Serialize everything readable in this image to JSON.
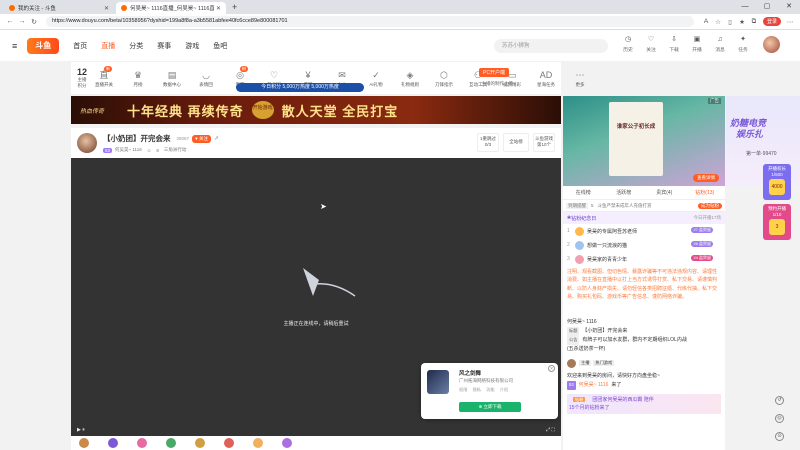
{
  "browser": {
    "tabs": [
      {
        "title": "我的关注 - 斗鱼",
        "active": false
      },
      {
        "title": "何吴昊~ 1116直播_何吴昊~ 1116直播_斗...",
        "active": true
      }
    ],
    "url": "https://www.douyu.com/beta/10358956?dyshid=199a8f8a-a3b5581abfee40fc6cce89e800081701",
    "login_label": "登录"
  },
  "header": {
    "logo": "斗鱼",
    "nav": [
      "首页",
      "直播",
      "分类",
      "赛事",
      "游戏",
      "鱼吧"
    ],
    "nav_active": "直播",
    "search_placeholder": "苏苏小狮狗",
    "right_items": [
      "历史",
      "关注",
      "下载",
      "开播",
      "消息",
      "任务"
    ]
  },
  "toolbar": {
    "level_num": "12",
    "level_label": "主播积分",
    "tools": [
      {
        "label": "直播开关",
        "icon": "直",
        "badge": "新"
      },
      {
        "label": "月榜",
        "icon": "♛",
        "badge": ""
      },
      {
        "label": "数据中心",
        "icon": "▤",
        "badge": ""
      },
      {
        "label": "表情回",
        "icon": "◡",
        "badge": ""
      },
      {
        "label": "贵宾",
        "icon": "◎",
        "badge": "粉"
      },
      {
        "label": "粉丝团",
        "icon": "♡",
        "badge": ""
      },
      {
        "label": "提现",
        "icon": "¥",
        "badge": ""
      },
      {
        "label": "中心",
        "icon": "✉",
        "badge": ""
      },
      {
        "label": "AI礼物",
        "icon": "✓",
        "badge": ""
      },
      {
        "label": "礼物规则",
        "icon": "◈",
        "badge": ""
      },
      {
        "label": "刀锋指示",
        "icon": "⬡",
        "badge": ""
      },
      {
        "label": "互动工具",
        "icon": "⚇",
        "badge": ""
      },
      {
        "label": "视频精彩",
        "icon": "▭",
        "badge": ""
      },
      {
        "label": "星海任务",
        "icon": "AD",
        "badge": ""
      },
      {
        "label": "更多",
        "icon": "⋯",
        "badge": ""
      }
    ],
    "pc_button": "PC开户端",
    "pc_sub": "主播的制作上传",
    "rank_toast": "今日积分 5,000万热度 5,000万热度"
  },
  "banner": {
    "game": "热血传奇",
    "text_left": "十年经典  再续传奇",
    "seal": "开始游戏",
    "text_right": "散人天堂  全民打宝"
  },
  "room": {
    "title": "【小奶团】开完会来",
    "hot": "28067",
    "follow_label": "关注",
    "level_badge": "53",
    "host_name": "何吴昊~ 1116",
    "fans_count": "8",
    "category": "三角洲行动",
    "buttons": [
      {
        "top": "1重跳过",
        "bottom": "0/3"
      },
      {
        "top": "全站榜",
        "bottom": ""
      },
      {
        "top": "斗鱼游戏",
        "bottom": "第10个"
      }
    ]
  },
  "player": {
    "message": "主播正在连线中，请稍后重试",
    "ctrl_left": "▶  ⏸",
    "ctrl_right": "⤢  ⛶"
  },
  "ad_popup": {
    "name": "风之剑舞",
    "company": "广州拓海网络科技有限公司",
    "tags": [
      "权限",
      "隐私",
      "功能",
      "介绍"
    ],
    "download_label": "立即下载"
  },
  "side": {
    "ad_label": "广告",
    "poster_title": "谁家公子初长成",
    "ad_button": "查看详情",
    "tabs": [
      "在线榜",
      "活跃榜",
      "贵宾(4)",
      "钻粉(13)"
    ],
    "active_tab": "钻粉(13)",
    "sub_left_badge": "到期提醒",
    "sub_left_num": "5",
    "sub_text": "斗鱼严禁未成年人充值打赏",
    "sub_right": "成为钻粉",
    "honor_title": "钻粉纪念日",
    "honor_right": "今日开播17场",
    "ranks": [
      {
        "n": "1",
        "name": "吴昊的专属阿吾苏老师",
        "badge": "27 盈贺留",
        "color": "#ffb84a"
      },
      {
        "n": "2",
        "name": "想做一只流浪的猫",
        "badge": "26 盈贺留",
        "color": "#a0c4f0"
      },
      {
        "n": "3",
        "name": "吴昊家的青青少年",
        "badge": "24 盈贺留",
        "color": "#f0a0b0"
      }
    ],
    "rules_text": "注明、观看截图、但切色情、暴露诈骗等不可违法违规内容、请理性消费、如主播在直播中以打上当方式诱导打赏、私下交易、请谨慎判断、以防人身财产损失、请勿轻信各类招聘征婚、代练代抽、私下交易、购买礼包码、游戏币等广告信息、谨防网络诈骗。",
    "chat": [
      {
        "tag": "",
        "user": "何吴昊~ 1116",
        "text": ""
      },
      {
        "tag": "标题",
        "user": "",
        "text": "【小奶团】开完会来"
      },
      {
        "tag": "公告",
        "user": "",
        "text": "有牌子可以加水友群，群内不定期组织LOL内战"
      },
      {
        "tag": "",
        "user": "",
        "text": "(五杀送奶茶一杯)"
      }
    ],
    "host_row_tags": [
      "主播",
      "热门游戏"
    ],
    "welcome": "欢迎来到吴昊的房间，请快好方向盘坐稳~",
    "join_level": "53",
    "join_user": "何吴昊~ 1116",
    "join_text": "来了",
    "notice_tag": "钻粉",
    "notice_line1": "团团家何吴昊的西瓜霸 陪伴",
    "notice_line2": "15个月的钻粉来了"
  },
  "promo": {
    "line1": "奶糖电竞",
    "line2": "娱乐扎",
    "line3": "第一单·99470"
  },
  "rail": [
    {
      "label": "开播权长",
      "sub": "1/500",
      "value": "4000",
      "color": "#7b6cf0"
    },
    {
      "label": "预约开播",
      "sub": "1/10",
      "value": "3",
      "color": "#e24a8a"
    }
  ],
  "rail_icons": [
    "↺",
    "◎",
    "⊙"
  ]
}
